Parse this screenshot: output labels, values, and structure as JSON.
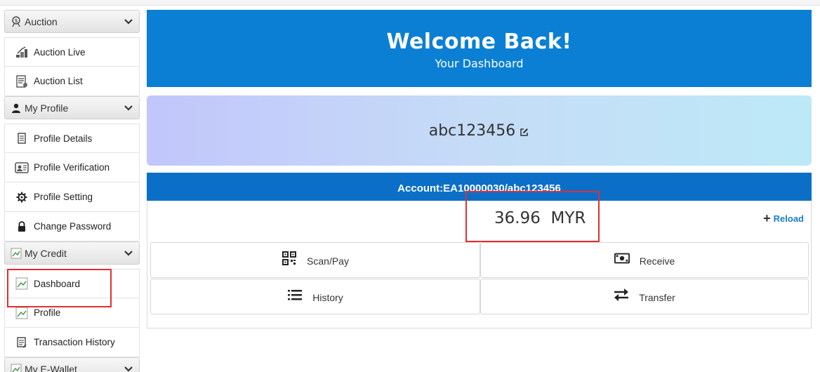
{
  "sidebar": {
    "auction": {
      "header": "Auction",
      "items": [
        "Auction Live",
        "Auction List"
      ]
    },
    "profile": {
      "header": "My Profile",
      "items": [
        "Profile Details",
        "Profile Verification",
        "Profile Setting",
        "Change Password"
      ]
    },
    "credit": {
      "header": "My Credit",
      "items": [
        "Dashboard",
        "Profile",
        "Transaction History"
      ]
    },
    "ewallet": {
      "header": "My E-Wallet"
    }
  },
  "main": {
    "welcome_title": "Welcome Back!",
    "welcome_subtitle": "Your Dashboard",
    "username": "abc123456",
    "account_label": "Account:EA10000030/abc123456",
    "balance_amount": "36.96",
    "balance_currency": "MYR",
    "reload_label": "Reload",
    "actions": {
      "scan_pay": "Scan/Pay",
      "receive": "Receive",
      "history": "History",
      "transfer": "Transfer"
    }
  },
  "colors": {
    "hero_blue": "#0b7fd4",
    "account_bar_blue": "#0b6fc8",
    "reload_blue": "#1a7fc0",
    "highlight_red": "#e03030"
  }
}
